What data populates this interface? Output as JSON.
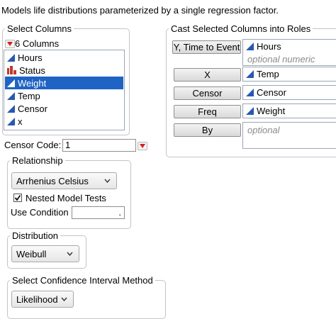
{
  "description": "Models life distributions parameterized by a single regression factor.",
  "select_columns": {
    "title": "Select Columns",
    "count_label": "6 Columns",
    "columns": [
      {
        "name": "Hours",
        "icon": "continuous-icon",
        "selected": false
      },
      {
        "name": "Status",
        "icon": "nominal-icon",
        "selected": false
      },
      {
        "name": "Weight",
        "icon": "continuous-icon",
        "selected": true
      },
      {
        "name": "Temp",
        "icon": "continuous-icon",
        "selected": false
      },
      {
        "name": "Censor",
        "icon": "continuous-icon",
        "selected": false
      },
      {
        "name": "x",
        "icon": "continuous-icon",
        "selected": false
      }
    ]
  },
  "cast_roles": {
    "title": "Cast Selected Columns into Roles",
    "roles": [
      {
        "button": "Y, Time to Event",
        "value": "Hours",
        "hint": "optional numeric"
      },
      {
        "button": "X",
        "value": "Temp"
      },
      {
        "button": "Censor",
        "value": "Censor"
      },
      {
        "button": "Freq",
        "value": "Weight"
      },
      {
        "button": "By",
        "hint": "optional"
      }
    ]
  },
  "censor_code": {
    "label": "Censor Code:",
    "value": "1"
  },
  "relationship": {
    "title": "Relationship",
    "selected": "Arrhenius Celsius",
    "nested_label": "Nested Model Tests",
    "nested_checked": true,
    "use_condition_label": "Use Condition",
    "use_condition_value": "."
  },
  "distribution": {
    "title": "Distribution",
    "selected": "Weibull"
  },
  "ci_method": {
    "title": "Select Confidence Interval Method",
    "selected": "Likelihood"
  },
  "colors": {
    "accent": "#1f63c4",
    "red_triangle": "#d42020",
    "continuous_icon": "#2a58b0",
    "nominal_icon": "#c0392b"
  }
}
